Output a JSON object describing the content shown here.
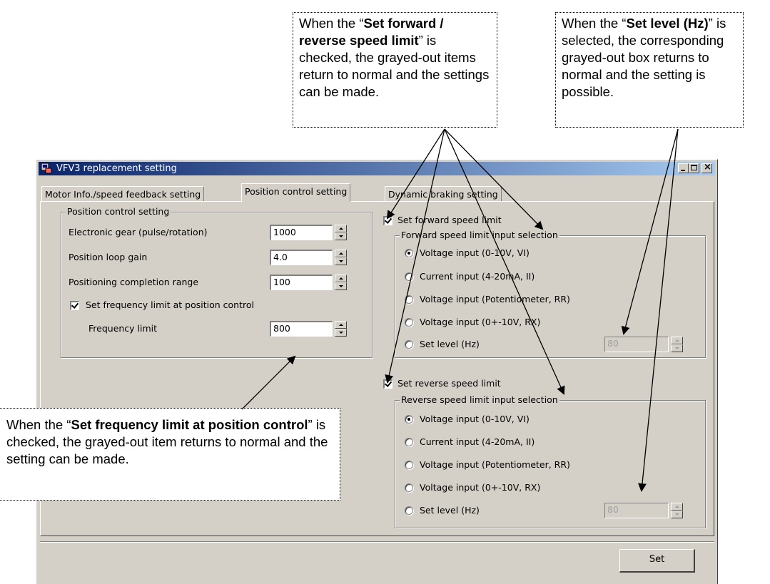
{
  "window": {
    "title": "VFV3 replacement setting"
  },
  "tabs": [
    {
      "label": "Motor Info./speed feedback setting",
      "active": false
    },
    {
      "label": "Position control setting",
      "active": true
    },
    {
      "label": "Dynamic braking setting",
      "active": false
    }
  ],
  "position_group": {
    "title": "Position control setting",
    "electronic_gear_label": "Electronic gear (pulse/rotation)",
    "electronic_gear_value": "1000",
    "loop_gain_label": "Position loop gain",
    "loop_gain_value": "4.0",
    "completion_label": "Positioning completion range",
    "completion_value": "100",
    "freq_limit_check_label": "Set frequency limit at position control",
    "freq_limit_label": "Frequency limit",
    "freq_limit_value": "800"
  },
  "forward": {
    "check_label": "Set forward speed limit",
    "group_title": "Forward speed limit input selection",
    "options": [
      "Voltage input (0-10V, VI)",
      "Current input (4-20mA, II)",
      "Voltage input (Potentiometer, RR)",
      "Voltage input (0+-10V, RX)",
      "Set level (Hz)"
    ],
    "level_value": "80"
  },
  "reverse": {
    "check_label": "Set reverse speed limit",
    "group_title": "Reverse speed limit input selection",
    "options": [
      "Voltage input (0-10V, VI)",
      "Current input (4-20mA, II)",
      "Voltage input (Potentiometer, RR)",
      "Voltage input (0+-10V, RX)",
      "Set level (Hz)"
    ],
    "level_value": "80"
  },
  "set_button": "Set",
  "callouts": {
    "speed_limit": {
      "pre": "When the “",
      "bold": "Set forward / reverse speed limit",
      "post": "” is checked, the grayed-out items return to normal and the settings can be made."
    },
    "set_level": {
      "pre": "When the “",
      "bold": "Set level (Hz)",
      "post": "” is selected, the corresponding grayed-out box returns to normal and the setting is possible."
    },
    "freq_limit": {
      "pre": "When the “",
      "bold": "Set frequency limit at position control",
      "post": "” is checked, the grayed-out item returns to normal and the setting can be made."
    }
  }
}
